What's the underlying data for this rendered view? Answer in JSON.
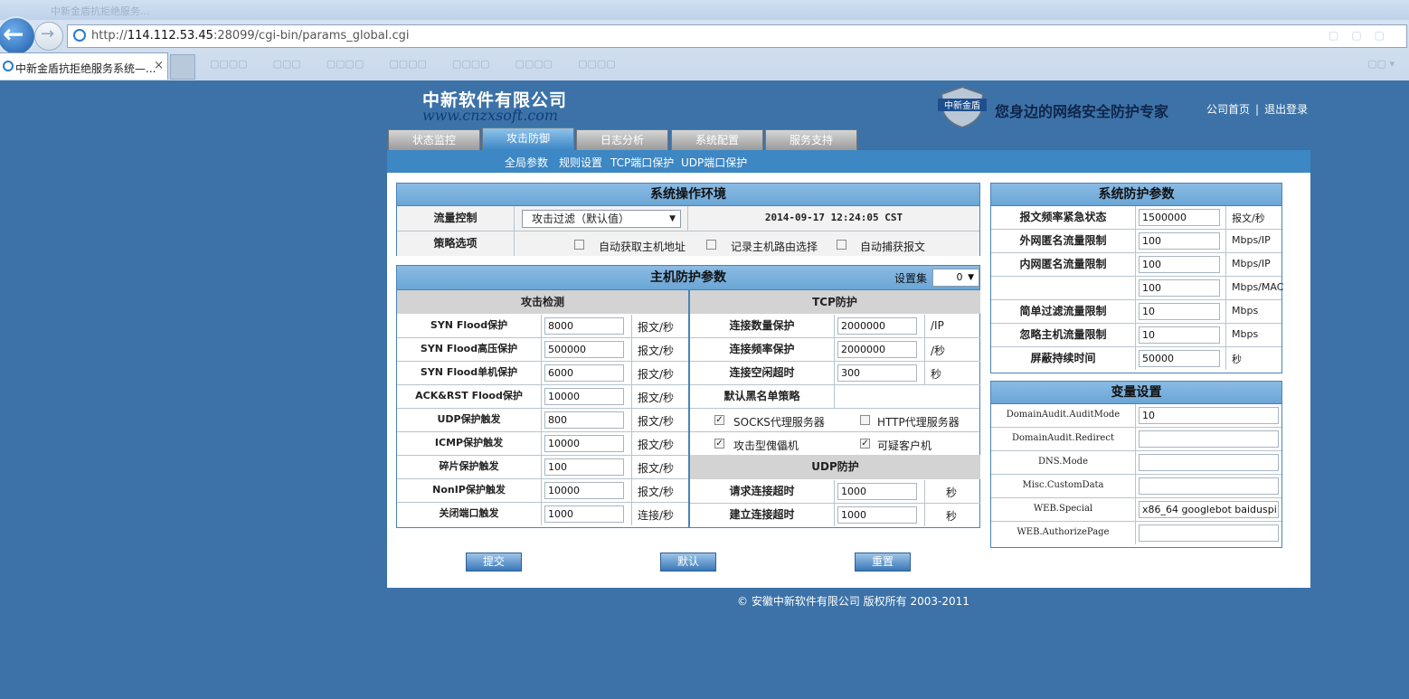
{
  "browser": {
    "title_ghost": "中新金盾抗拒绝服务...",
    "url_prefix": "http://",
    "url_host": "114.112.53.45",
    "url_rest": ":28099/cgi-bin/params_global.cgi",
    "tab_title": "中新金盾抗拒绝服务系统—...",
    "tab_close": "×"
  },
  "header": {
    "company": "中新软件有限公司",
    "website": "www.cnzxsoft.com",
    "shield_text": "中新金盾",
    "slogan": "您身边的网络安全防护专家",
    "link_home": "公司首页",
    "link_sep": "|",
    "link_logout": "退出登录"
  },
  "main_tabs": [
    "状态监控",
    "攻击防御",
    "日志分析",
    "系统配置",
    "服务支持"
  ],
  "sub_tabs": [
    "全局参数",
    "规则设置",
    "TCP端口保护",
    "UDP端口保护"
  ],
  "env": {
    "title": "系统操作环境",
    "flow_label": "流量控制",
    "flow_value": "攻击过滤（默认值）",
    "datetime": "2014-09-17 12:24:05 CST",
    "policy_label": "策略选项",
    "opt1": "自动获取主机地址",
    "opt2": "记录主机路由选择",
    "opt3": "自动捕获报文"
  },
  "host": {
    "title": "主机防护参数",
    "set_label": "设置集",
    "set_value": "0",
    "attack_title": "攻击检测",
    "tcp_title": "TCP防护",
    "udp_title": "UDP防护",
    "attack_rows": [
      {
        "label": "SYN Flood保护",
        "value": "8000",
        "unit": "报文/秒"
      },
      {
        "label": "SYN Flood高压保护",
        "value": "500000",
        "unit": "报文/秒"
      },
      {
        "label": "SYN Flood单机保护",
        "value": "6000",
        "unit": "报文/秒"
      },
      {
        "label": "ACK&RST Flood保护",
        "value": "10000",
        "unit": "报文/秒"
      },
      {
        "label": "UDP保护触发",
        "value": "800",
        "unit": "报文/秒"
      },
      {
        "label": "ICMP保护触发",
        "value": "10000",
        "unit": "报文/秒"
      },
      {
        "label": "碎片保护触发",
        "value": "100",
        "unit": "报文/秒"
      },
      {
        "label": "NonIP保护触发",
        "value": "10000",
        "unit": "报文/秒"
      },
      {
        "label": "关闭端口触发",
        "value": "1000",
        "unit": "连接/秒"
      }
    ],
    "tcp_rows": [
      {
        "label": "连接数量保护",
        "value": "2000000",
        "unit": "/IP"
      },
      {
        "label": "连接频率保护",
        "value": "2000000",
        "unit": "/秒"
      },
      {
        "label": "连接空闲超时",
        "value": "300",
        "unit": "秒"
      }
    ],
    "blacklist_label": "默认黑名单策略",
    "bl_socks": "SOCKS代理服务器",
    "bl_http": "HTTP代理服务器",
    "bl_zombie": "攻击型傀儡机",
    "bl_suspect": "可疑客户机",
    "udp_rows": [
      {
        "label": "请求连接超时",
        "value": "1000",
        "unit": "秒"
      },
      {
        "label": "建立连接超时",
        "value": "1000",
        "unit": "秒"
      }
    ]
  },
  "sys": {
    "title": "系统防护参数",
    "rows": [
      {
        "label": "报文频率紧急状态",
        "value": "1500000",
        "unit": "报文/秒"
      },
      {
        "label": "外网匿名流量限制",
        "value": "100",
        "unit": "Mbps/IP"
      },
      {
        "label": "内网匿名流量限制",
        "value": "100",
        "unit": "Mbps/IP"
      },
      {
        "label": "",
        "value": "100",
        "unit": "Mbps/MAC"
      },
      {
        "label": "简单过滤流量限制",
        "value": "10",
        "unit": "Mbps"
      },
      {
        "label": "忽略主机流量限制",
        "value": "10",
        "unit": "Mbps"
      },
      {
        "label": "屏蔽持续时间",
        "value": "50000",
        "unit": "秒"
      }
    ]
  },
  "vars": {
    "title": "变量设置",
    "rows": [
      {
        "label": "DomainAudit.AuditMode",
        "value": "10"
      },
      {
        "label": "DomainAudit.Redirect",
        "value": ""
      },
      {
        "label": "DNS.Mode",
        "value": ""
      },
      {
        "label": "Misc.CustomData",
        "value": ""
      },
      {
        "label": "WEB.Special",
        "value": "x86_64 googlebot baiduspi"
      },
      {
        "label": "WEB.AuthorizePage",
        "value": ""
      }
    ]
  },
  "buttons": {
    "submit": "提交",
    "default": "默认",
    "reset": "重置"
  },
  "footer": "© 安徽中新软件有限公司  版权所有  2003-2011"
}
